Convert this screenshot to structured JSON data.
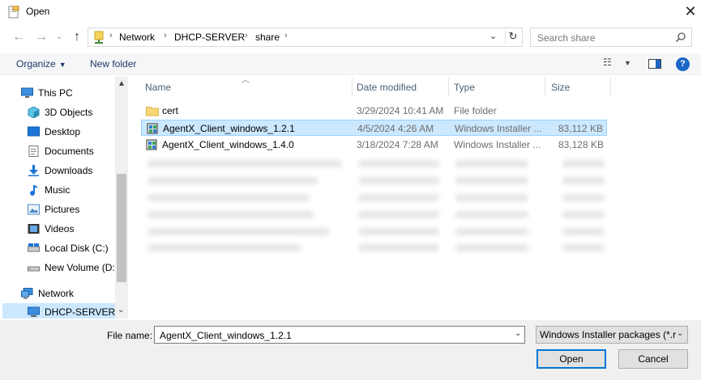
{
  "window": {
    "title": "Open"
  },
  "address": {
    "crumbs": [
      "Network",
      "DHCP-SERVER",
      "share"
    ],
    "search_placeholder": "Search share"
  },
  "toolbar": {
    "organize": "Organize",
    "new_folder": "New folder"
  },
  "nav": {
    "items": [
      {
        "label": "This PC",
        "icon": "this-pc-icon"
      },
      {
        "label": "3D Objects",
        "icon": "3d-objects-icon"
      },
      {
        "label": "Desktop",
        "icon": "desktop-icon"
      },
      {
        "label": "Documents",
        "icon": "documents-icon"
      },
      {
        "label": "Downloads",
        "icon": "downloads-icon"
      },
      {
        "label": "Music",
        "icon": "music-icon"
      },
      {
        "label": "Pictures",
        "icon": "pictures-icon"
      },
      {
        "label": "Videos",
        "icon": "videos-icon"
      },
      {
        "label": "Local Disk (C:)",
        "icon": "local-disk-icon"
      },
      {
        "label": "New Volume (D:)",
        "icon": "drive-icon"
      },
      {
        "label": "Network",
        "icon": "network-icon"
      },
      {
        "label": "DHCP-SERVER",
        "icon": "computer-icon"
      }
    ]
  },
  "columns": {
    "name": "Name",
    "date": "Date modified",
    "type": "Type",
    "size": "Size"
  },
  "files": [
    {
      "name": "cert",
      "date": "3/29/2024 10:41 AM",
      "type": "File folder",
      "size": "",
      "icon": "folder-icon"
    },
    {
      "name": "AgentX_Client_windows_1.2.1",
      "date": "4/5/2024 4:26 AM",
      "type": "Windows Installer ...",
      "size": "83,112 KB",
      "icon": "installer-icon"
    },
    {
      "name": "AgentX_Client_windows_1.4.0",
      "date": "3/18/2024 7:28 AM",
      "type": "Windows Installer ...",
      "size": "83,128 KB",
      "icon": "installer-icon"
    }
  ],
  "footer": {
    "file_name_label": "File name:",
    "file_name_value": "AgentX_Client_windows_1.2.1",
    "file_type": "Windows Installer packages (*.r",
    "open": "Open",
    "cancel": "Cancel"
  }
}
